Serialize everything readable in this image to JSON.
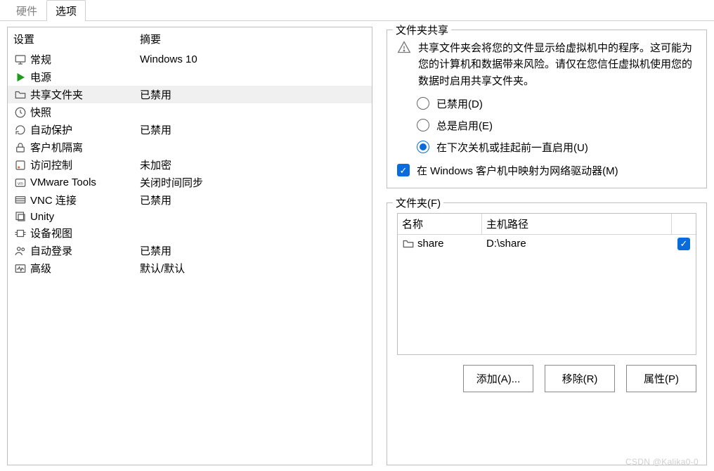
{
  "tabs": {
    "hardware": "硬件",
    "options": "选项"
  },
  "list": {
    "headers": {
      "setting": "设置",
      "summary": "摘要"
    },
    "items": [
      {
        "icon": "monitor-icon",
        "label": "常规",
        "summary": "Windows 10"
      },
      {
        "icon": "play-icon",
        "label": "电源",
        "summary": ""
      },
      {
        "icon": "folder-icon",
        "label": "共享文件夹",
        "summary": "已禁用",
        "selected": true
      },
      {
        "icon": "clock-icon",
        "label": "快照",
        "summary": ""
      },
      {
        "icon": "refresh-icon",
        "label": "自动保护",
        "summary": "已禁用"
      },
      {
        "icon": "lock-icon",
        "label": "客户机隔离",
        "summary": ""
      },
      {
        "icon": "shield-icon",
        "label": "访问控制",
        "summary": "未加密"
      },
      {
        "icon": "vm-icon",
        "label": "VMware Tools",
        "summary": "关闭时间同步"
      },
      {
        "icon": "vnc-icon",
        "label": "VNC 连接",
        "summary": "已禁用"
      },
      {
        "icon": "windows-icon",
        "label": "Unity",
        "summary": ""
      },
      {
        "icon": "chip-icon",
        "label": "设备视图",
        "summary": ""
      },
      {
        "icon": "user-icon",
        "label": "自动登录",
        "summary": "已禁用"
      },
      {
        "icon": "pulse-icon",
        "label": "高级",
        "summary": "默认/默认"
      }
    ]
  },
  "share": {
    "groupTitle": "文件夹共享",
    "warning": "共享文件夹会将您的文件显示给虚拟机中的程序。这可能为您的计算机和数据带来风险。请仅在您信任虚拟机使用您的数据时启用共享文件夹。",
    "radios": {
      "disabled": "已禁用(D)",
      "always": "总是启用(E)",
      "untilOff": "在下次关机或挂起前一直启用(U)"
    },
    "mapDrive": "在 Windows 客户机中映射为网络驱动器(M)"
  },
  "folders": {
    "groupTitle": "文件夹(F)",
    "headers": {
      "name": "名称",
      "host": "主机路径"
    },
    "rows": [
      {
        "name": "share",
        "path": "D:\\share",
        "checked": true
      }
    ],
    "buttons": {
      "add": "添加(A)...",
      "remove": "移除(R)",
      "props": "属性(P)"
    }
  },
  "watermark": "CSDN @Kalika0-0"
}
